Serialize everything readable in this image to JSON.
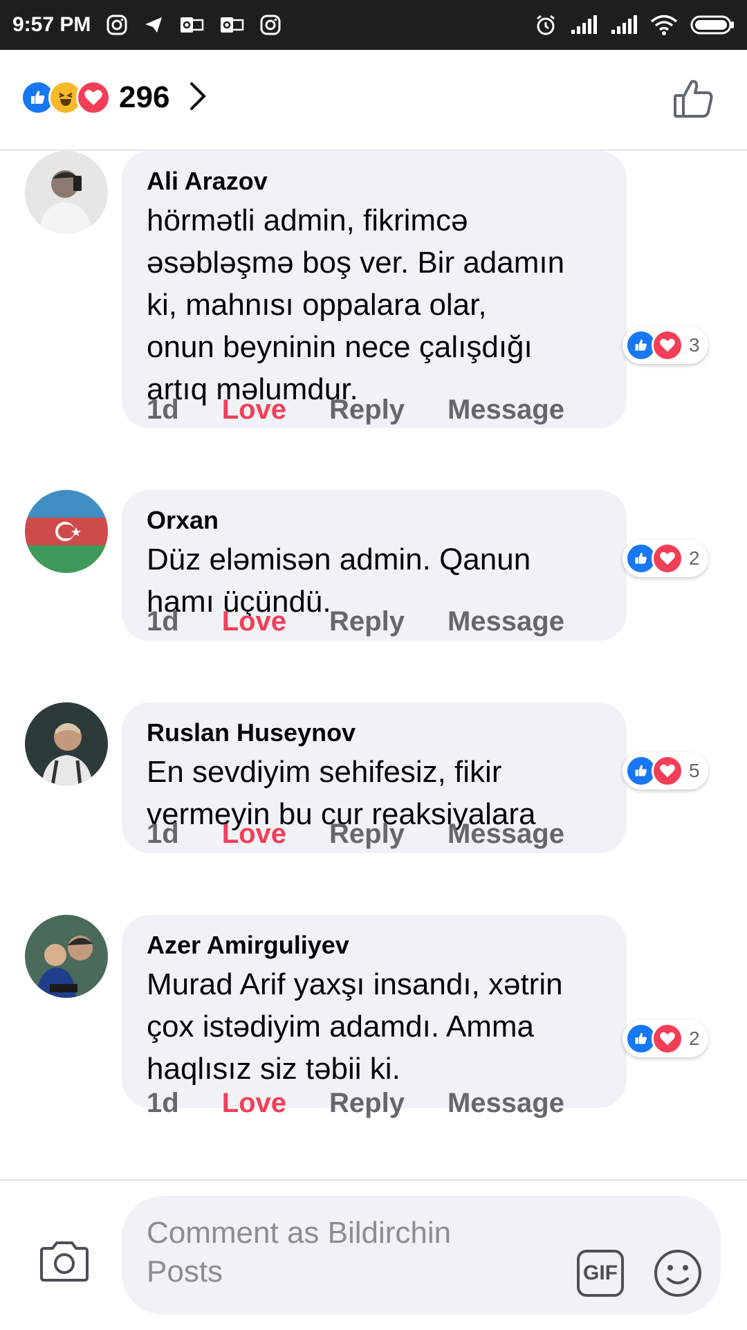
{
  "status_bar": {
    "time": "9:57 PM"
  },
  "reactions_header": {
    "count": "296"
  },
  "comments": [
    {
      "name": "Ali Arazov",
      "lines": [
        "hörmətli admin, fikrimcə",
        "əsəbləşmə boş ver. Bir adamın",
        "ki,  mahnısı oppalara olar,",
        "onun beyninin nece çalışdığı",
        "artıq məlumdur."
      ],
      "time": "1d",
      "love": "Love",
      "reply": "Reply",
      "message": "Message",
      "reaction_count": "3"
    },
    {
      "name": "Orxan",
      "lines": [
        "Düz eləmisən admin. Qanun",
        "hamı üçündü."
      ],
      "time": "1d",
      "love": "Love",
      "reply": "Reply",
      "message": "Message",
      "reaction_count": "2"
    },
    {
      "name": "Ruslan Huseynov",
      "lines": [
        "En sevdiyim sehifesiz, fikir",
        "vermeyin bu cur reaksiyalara"
      ],
      "time": "1d",
      "love": "Love",
      "reply": "Reply",
      "message": "Message",
      "reaction_count": "5"
    },
    {
      "name": "Azer Amirguliyev",
      "lines": [
        "Murad Arif yaxşı insandı, xətrin",
        "çox istədiyim adamdı. Amma",
        "haqlısız siz təbii ki."
      ],
      "time": "1d",
      "love": "Love",
      "reply": "Reply",
      "message": "Message",
      "reaction_count": "2"
    }
  ],
  "composer": {
    "placeholder": "Comment as Bildirchin Posts",
    "gif_label": "GIF"
  },
  "colors": {
    "like_blue": "#1877f2",
    "love_red": "#f33e58",
    "bubble_gray": "#f0f2f5"
  }
}
